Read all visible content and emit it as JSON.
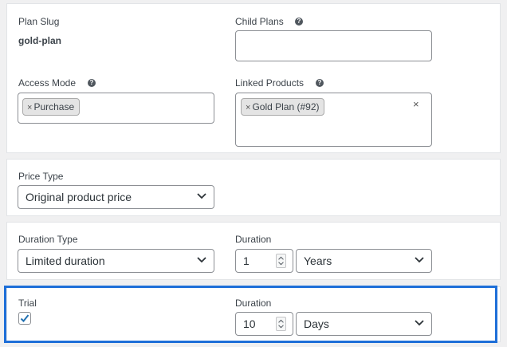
{
  "plan_slug": {
    "label": "Plan Slug",
    "value": "gold-plan"
  },
  "child_plans": {
    "label": "Child Plans",
    "help_icon": "help-icon",
    "value": ""
  },
  "access_mode": {
    "label": "Access Mode",
    "help_icon": "help-icon",
    "tags": [
      "Purchase"
    ],
    "remove_glyph": "×"
  },
  "linked_products": {
    "label": "Linked Products",
    "help_icon": "help-icon",
    "tags": [
      "Gold Plan (#92)"
    ],
    "remove_glyph": "×",
    "clear_glyph": "×"
  },
  "price_type": {
    "label": "Price Type",
    "selected": "Original product price"
  },
  "duration_type": {
    "label": "Duration Type",
    "selected": "Limited duration"
  },
  "duration": {
    "label": "Duration",
    "value": "1",
    "unit": "Years"
  },
  "trial": {
    "label": "Trial",
    "checked": true
  },
  "trial_duration": {
    "label": "Duration",
    "value": "10",
    "unit": "Days"
  },
  "colors": {
    "highlight": "#1e6fd8",
    "panel_bg": "#ffffff",
    "page_bg": "#f0f0f1",
    "checkmark": "#2271b1"
  }
}
